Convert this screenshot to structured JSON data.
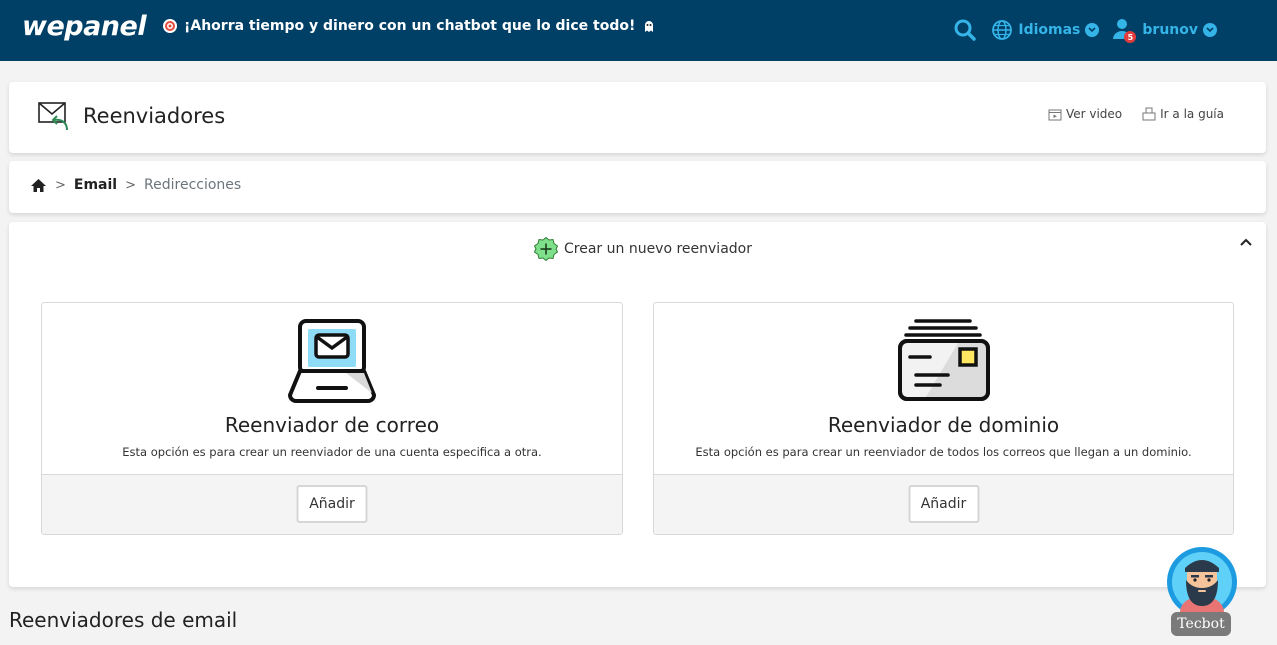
{
  "topbar": {
    "logo": "wepanel",
    "promo_text": "¡Ahorra tiempo y dinero con un chatbot que lo dice todo!",
    "languages_label": "Idiomas",
    "username": "brunov",
    "notification_count": "5",
    "accent_color": "#35b4e8",
    "background_color": "#003f66"
  },
  "page": {
    "title": "Reenviadores",
    "title_icon": "envelope-forward-icon",
    "links": {
      "video": "Ver video",
      "guide": "Ir a la guía"
    }
  },
  "breadcrumb": {
    "home_icon": "home-icon",
    "items": [
      "Email",
      "Redirecciones"
    ]
  },
  "create": {
    "header": "Crear un nuevo reenviador",
    "options": [
      {
        "title": "Reenviador de correo",
        "description": "Esta opción es para crear un reenviador de una cuenta especifica a otra.",
        "button": "Añadir",
        "icon": "laptop-mail-icon"
      },
      {
        "title": "Reenviador de dominio",
        "description": "Esta opción es para crear un reenviador de todos los correos que llegan a un dominio.",
        "button": "Añadir",
        "icon": "stacked-letters-icon"
      }
    ]
  },
  "section_heading": "Reenviadores de email",
  "chatbot": {
    "label": "Tecbot"
  }
}
